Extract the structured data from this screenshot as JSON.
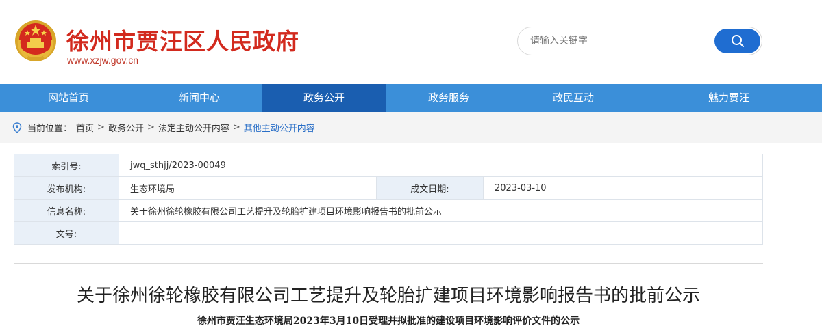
{
  "header": {
    "site_title": "徐州市贾汪区人民政府",
    "site_url": "www.xzjw.gov.cn",
    "search_placeholder": "请输入关键字"
  },
  "nav": {
    "items": [
      {
        "label": "网站首页",
        "active": false
      },
      {
        "label": "新闻中心",
        "active": false
      },
      {
        "label": "政务公开",
        "active": true
      },
      {
        "label": "政务服务",
        "active": false
      },
      {
        "label": "政民互动",
        "active": false
      },
      {
        "label": "魅力贾汪",
        "active": false
      }
    ]
  },
  "breadcrumb": {
    "prefix": "当前位置：",
    "items": [
      "首页",
      "政务公开",
      "法定主动公开内容"
    ],
    "current": "其他主动公开内容",
    "separator": ">"
  },
  "info": {
    "index_label": "索引号:",
    "index_value": "jwq_sthjj/2023-00049",
    "publisher_label": "发布机构:",
    "publisher_value": "生态环境局",
    "date_label": "成文日期:",
    "date_value": "2023-03-10",
    "name_label": "信息名称:",
    "name_value": "关于徐州徐轮橡胶有限公司工艺提升及轮胎扩建项目环境影响报告书的批前公示",
    "doc_label": "文号:",
    "doc_value": ""
  },
  "article": {
    "title": "关于徐州徐轮橡胶有限公司工艺提升及轮胎扩建项目环境影响报告书的批前公示",
    "subtitle": "徐州市贾汪生态环境局2023年3月10日受理并拟批准的建设项目环境影响评价文件的公示"
  },
  "colors": {
    "brand_red": "#d22a1e",
    "nav_blue": "#3b8fd9",
    "nav_active": "#1a5eb0",
    "search_button": "#1f6dd1"
  },
  "icons": {
    "emblem": "national-emblem-icon",
    "search": "search-icon",
    "location": "location-pin-icon"
  }
}
